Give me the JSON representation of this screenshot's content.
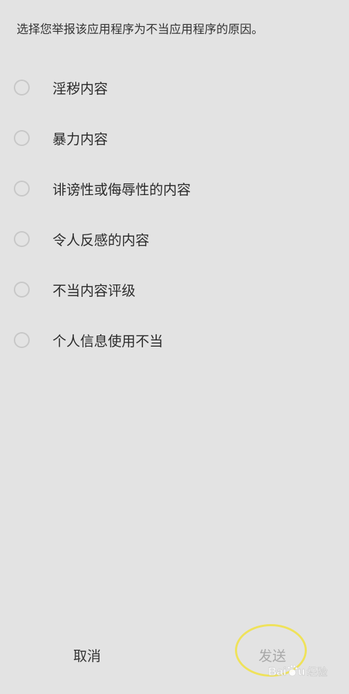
{
  "prompt": "选择您举报该应用程序为不当应用程序的原因。",
  "options": [
    {
      "label": "淫秽内容"
    },
    {
      "label": "暴力内容"
    },
    {
      "label": "诽谤性或侮辱性的内容"
    },
    {
      "label": "令人反感的内容"
    },
    {
      "label": "不当内容评级"
    },
    {
      "label": "个人信息使用不当"
    }
  ],
  "footer": {
    "cancel_label": "取消",
    "send_label": "发送"
  },
  "watermark": {
    "text": "Baidu经验"
  },
  "colors": {
    "background": "#e3e3e3",
    "radio_border": "#c7c7c7",
    "send_disabled": "#a8a8a8",
    "highlight_circle": "#efe25a"
  }
}
